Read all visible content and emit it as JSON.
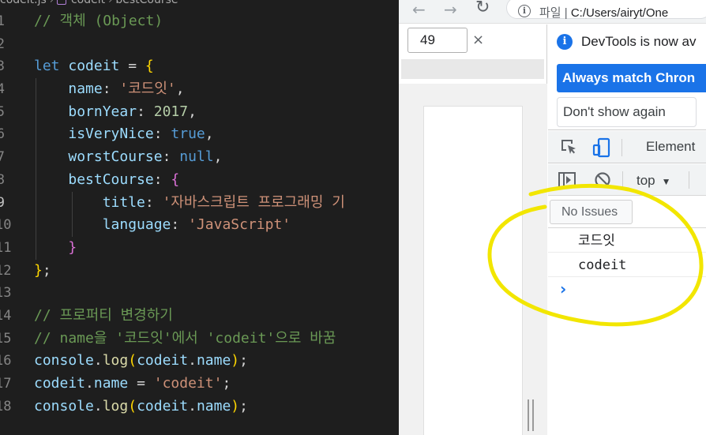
{
  "editor": {
    "breadcrumb": [
      "codeit.js",
      "codeit",
      "bestCourse"
    ],
    "lines": [
      {
        "num": "1",
        "tokens": [
          {
            "c": "c",
            "t": "// 객체 (Object)"
          }
        ]
      },
      {
        "num": "2",
        "tokens": []
      },
      {
        "num": "3",
        "tokens": [
          {
            "c": "k",
            "t": "let"
          },
          {
            "c": "w",
            "t": " "
          },
          {
            "c": "v",
            "t": "codeit"
          },
          {
            "c": "w",
            "t": " = "
          },
          {
            "c": "b1",
            "t": "{"
          }
        ]
      },
      {
        "num": "4",
        "tokens": [
          {
            "c": "w",
            "t": "    "
          },
          {
            "c": "p",
            "t": "name"
          },
          {
            "c": "w",
            "t": ": "
          },
          {
            "c": "s",
            "t": "'코드잇'"
          },
          {
            "c": "w",
            "t": ","
          }
        ]
      },
      {
        "num": "5",
        "tokens": [
          {
            "c": "w",
            "t": "    "
          },
          {
            "c": "p",
            "t": "bornYear"
          },
          {
            "c": "w",
            "t": ": "
          },
          {
            "c": "n",
            "t": "2017"
          },
          {
            "c": "w",
            "t": ","
          }
        ]
      },
      {
        "num": "6",
        "tokens": [
          {
            "c": "w",
            "t": "    "
          },
          {
            "c": "p",
            "t": "isVeryNice"
          },
          {
            "c": "w",
            "t": ": "
          },
          {
            "c": "k",
            "t": "true"
          },
          {
            "c": "w",
            "t": ","
          }
        ]
      },
      {
        "num": "7",
        "tokens": [
          {
            "c": "w",
            "t": "    "
          },
          {
            "c": "p",
            "t": "worstCourse"
          },
          {
            "c": "w",
            "t": ": "
          },
          {
            "c": "k",
            "t": "null"
          },
          {
            "c": "w",
            "t": ","
          }
        ]
      },
      {
        "num": "8",
        "tokens": [
          {
            "c": "w",
            "t": "    "
          },
          {
            "c": "p",
            "t": "bestCourse"
          },
          {
            "c": "w",
            "t": ": "
          },
          {
            "c": "b2",
            "t": "{"
          }
        ]
      },
      {
        "num": "9",
        "tokens": [
          {
            "c": "w",
            "t": "        "
          },
          {
            "c": "p",
            "t": "title"
          },
          {
            "c": "w",
            "t": ": "
          },
          {
            "c": "s",
            "t": "'자바스크립트 프로그래밍 기"
          }
        ]
      },
      {
        "num": "10",
        "tokens": [
          {
            "c": "w",
            "t": "        "
          },
          {
            "c": "p",
            "t": "language"
          },
          {
            "c": "w",
            "t": ": "
          },
          {
            "c": "s",
            "t": "'JavaScript'"
          }
        ]
      },
      {
        "num": "11",
        "tokens": [
          {
            "c": "w",
            "t": "    "
          },
          {
            "c": "b2",
            "t": "}"
          }
        ]
      },
      {
        "num": "12",
        "tokens": [
          {
            "c": "b1",
            "t": "}"
          },
          {
            "c": "w",
            "t": ";"
          }
        ]
      },
      {
        "num": "13",
        "tokens": []
      },
      {
        "num": "14",
        "tokens": [
          {
            "c": "c",
            "t": "// 프로퍼티 변경하기"
          }
        ]
      },
      {
        "num": "15",
        "tokens": [
          {
            "c": "c",
            "t": "// name을 '코드잇'에서 'codeit'으로 바꿈"
          }
        ]
      },
      {
        "num": "16",
        "tokens": [
          {
            "c": "v",
            "t": "console"
          },
          {
            "c": "w",
            "t": "."
          },
          {
            "c": "f",
            "t": "log"
          },
          {
            "c": "b1",
            "t": "("
          },
          {
            "c": "v",
            "t": "codeit"
          },
          {
            "c": "w",
            "t": "."
          },
          {
            "c": "v",
            "t": "name"
          },
          {
            "c": "b1",
            "t": ")"
          },
          {
            "c": "w",
            "t": ";"
          }
        ]
      },
      {
        "num": "17",
        "tokens": [
          {
            "c": "v",
            "t": "codeit"
          },
          {
            "c": "w",
            "t": "."
          },
          {
            "c": "v",
            "t": "name"
          },
          {
            "c": "w",
            "t": " = "
          },
          {
            "c": "s",
            "t": "'codeit'"
          },
          {
            "c": "w",
            "t": ";"
          }
        ]
      },
      {
        "num": "18",
        "tokens": [
          {
            "c": "v",
            "t": "console"
          },
          {
            "c": "w",
            "t": "."
          },
          {
            "c": "f",
            "t": "log"
          },
          {
            "c": "b1",
            "t": "("
          },
          {
            "c": "v",
            "t": "codeit"
          },
          {
            "c": "w",
            "t": "."
          },
          {
            "c": "v",
            "t": "name"
          },
          {
            "c": "b1",
            "t": ")"
          },
          {
            "c": "w",
            "t": ";"
          }
        ]
      }
    ],
    "active_line": 9
  },
  "browser": {
    "back_icon": "arrow-left-icon",
    "forward_icon": "arrow-right-icon",
    "reload_icon": "reload-icon",
    "url_prefix": "파일",
    "url_path": "C:/Users/airyt/One",
    "viewport_width_value": "49",
    "close_symbol": "×"
  },
  "devtools": {
    "banner_text": "DevTools is now av",
    "always_match_label": "Always match Chron",
    "dont_show_label": "Don't show again",
    "elements_tab_label": "Element",
    "context_label": "top",
    "issues_label": "No Issues",
    "console_messages": [
      "코드잇",
      "codeit"
    ],
    "prompt_symbol": "›"
  },
  "colors": {
    "editor_bg": "#1e1e1e",
    "accent_blue": "#1a73e8",
    "annotation_yellow": "#f2e600"
  }
}
